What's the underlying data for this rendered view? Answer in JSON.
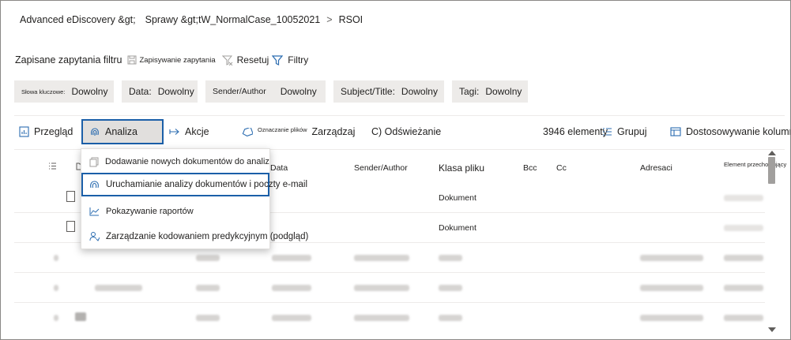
{
  "breadcrumb": {
    "item1": "Advanced eDiscovery &gt;",
    "item2": "Sprawy &gt;",
    "item3": "tW_NormalCase_10052021",
    "separator": ">",
    "current": "RSOI"
  },
  "queries_bar": {
    "title": "Zapisane zapytania filtru",
    "save_label": "Zapisywanie zapytania",
    "reset_label": "Resetuj",
    "filters_label": "Filtry"
  },
  "filters": [
    {
      "label": "Słowa kluczowe:",
      "value": "Dowolny"
    },
    {
      "label": "Data:",
      "value": "Dowolny"
    },
    {
      "label": "Sender/Author",
      "value": "Dowolny"
    },
    {
      "label": "Subject/Title:",
      "value": "Dowolny"
    },
    {
      "label": "Tagi:",
      "value": "Dowolny"
    }
  ],
  "toolbar": {
    "review": "Przegląd",
    "analysis": "Analiza",
    "actions": "Akcje",
    "tag_label": "Oznaczanie plików",
    "manage": "Zarządzaj",
    "refresh": "C) Odświeżanie",
    "count": "3946 elementy",
    "group": "Grupuj",
    "customize": "Dostosowywanie kolumn"
  },
  "columns": {
    "date": "Data",
    "sender": "Sender/Author",
    "file_class": "Klasa pliku",
    "bcc": "Bcc",
    "cc": "Cc",
    "recipients": "Adresaci",
    "item": "Element przechowujący"
  },
  "rows": [
    {
      "file_class": "Dokument"
    },
    {
      "file_class": "Dokument"
    }
  ],
  "menu": {
    "items": [
      {
        "label": "Dodawanie nowych dokumentów do analiz",
        "icon": "add-documents-icon"
      },
      {
        "label": "Uruchamianie analizy dokumentów i poczty e-mail",
        "icon": "analysis-icon"
      },
      {
        "label": "Pokazywanie raportów",
        "icon": "chart-icon"
      },
      {
        "label": "Zarządzanie kodowaniem predykcyjnym (podgląd)",
        "icon": "predictive-coding-icon"
      }
    ]
  },
  "colors": {
    "accent": "#1b5fa8",
    "chip_bg": "#edebe9",
    "selected_bg": "#e1dfdd"
  }
}
